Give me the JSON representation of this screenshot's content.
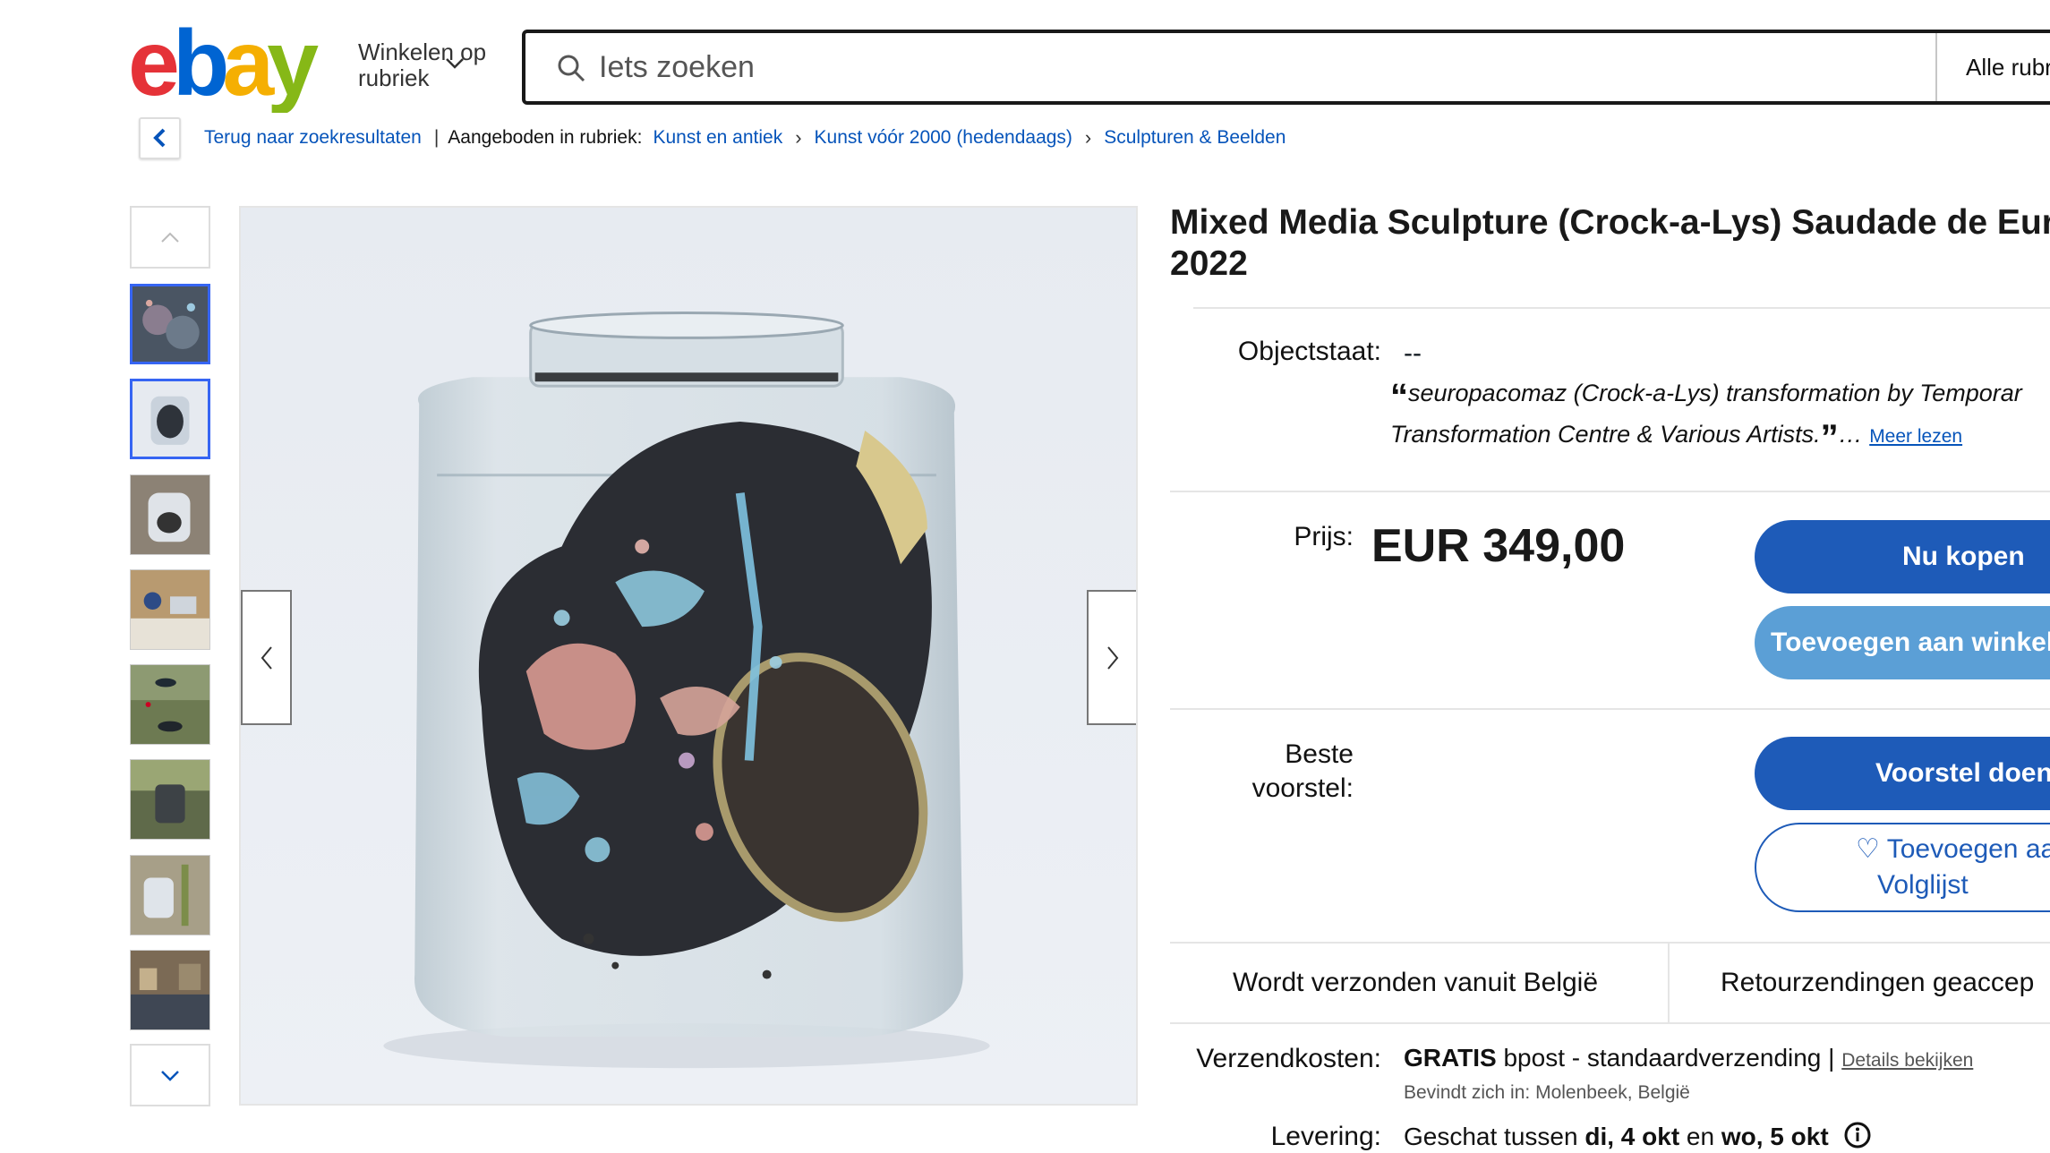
{
  "header": {
    "logo_text": "ebay",
    "shop_by_category": [
      "Winkelen op",
      "rubriek"
    ],
    "search_placeholder": "Iets zoeken",
    "category_select": "Alle rubr"
  },
  "breadcrumb": {
    "back_label": "Terug naar zoekresultaten",
    "listed_in": "Aangeboden in rubriek:",
    "items": [
      "Kunst en antiek",
      "Kunst vóór 2000 (hedendaags)",
      "Sculpturen & Beelden"
    ]
  },
  "gallery": {
    "thumbnail_count": 8,
    "active_index": 1
  },
  "item": {
    "title_line1": "Mixed Media Sculpture (Crock-a-Lys) Saudade de Europ",
    "title_line2": "2022",
    "condition_label": "Objectstaat:",
    "condition_value": "--",
    "quote_line1": "seuropacomaz (Crock-a-Lys) transformation by Temporar",
    "quote_line2": "Transformation Centre & Various Artists.",
    "read_more": "Meer lezen",
    "price_label": "Prijs:",
    "price": "EUR 349,00",
    "best_offer_label": [
      "Beste",
      "voorstel:"
    ],
    "buy_now": "Nu kopen",
    "add_to_cart": "Toevoegen aan winkelw",
    "make_offer": "Voorstel doen",
    "watchlist": [
      "Toevoegen aa",
      "Volglijst"
    ]
  },
  "shipping": {
    "ships_from": "Wordt verzonden vanuit België",
    "returns": "Retourzendingen geaccep",
    "cost_label": "Verzendkosten:",
    "cost_free": "GRATIS",
    "cost_method": "bpost - standaardverzending",
    "details_link": "Details bekijken",
    "location": "Bevindt zich in: Molenbeek, België",
    "delivery_label": "Levering:",
    "delivery_prefix": "Geschat tussen",
    "delivery_from": "di, 4 okt",
    "delivery_and": "en",
    "delivery_to": "wo, 5 okt"
  },
  "colors": {
    "ebay_red": "#e53238",
    "ebay_blue": "#0064d2",
    "ebay_yellow": "#f5af02",
    "ebay_green": "#86b817",
    "link_blue": "#0654ba",
    "button_primary": "#1e5bb8",
    "button_light": "#5b9fd6"
  }
}
